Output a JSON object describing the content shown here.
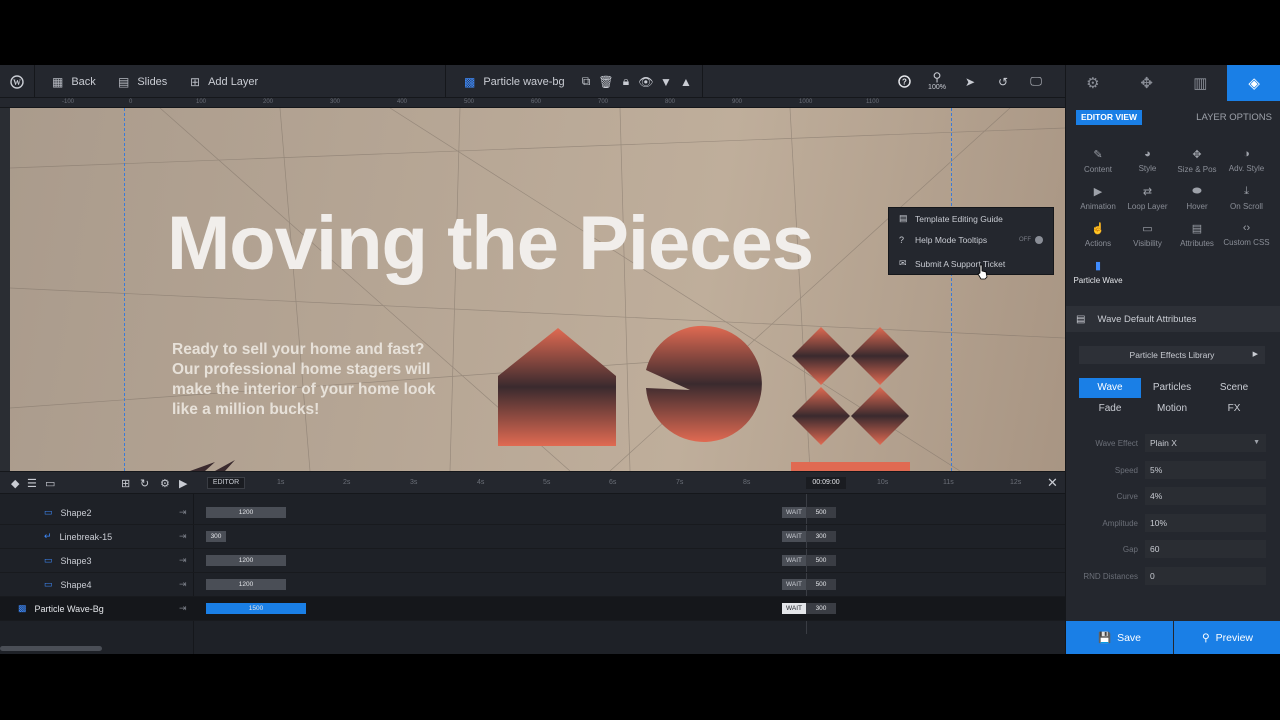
{
  "toolbar": {
    "back_label": "Back",
    "slides_label": "Slides",
    "add_layer_label": "Add Layer",
    "layer_title": "Particle wave-bg",
    "zoom": "100%"
  },
  "ruler": {
    "ticks": [
      "-100",
      "0",
      "100",
      "200",
      "300",
      "400",
      "500",
      "600",
      "700",
      "800",
      "900",
      "1000",
      "1100"
    ]
  },
  "canvas": {
    "headline": "Moving the Pieces",
    "subtext": "Ready to sell your home and fast? Our professional home stagers will make the interior of your home look like a million bucks!"
  },
  "help_menu": {
    "items": [
      {
        "label": "Template Editing Guide",
        "icon": "book-icon"
      },
      {
        "label": "Help Mode Tooltips",
        "icon": "help-icon"
      },
      {
        "label": "Submit A Support Ticket",
        "icon": "ticket-icon"
      }
    ],
    "tooltips_state": "OFF"
  },
  "timeline": {
    "editor_tab": "EDITOR",
    "time_marks": [
      "1s",
      "2s",
      "3s",
      "4s",
      "5s",
      "6s",
      "7s",
      "8s",
      "10s",
      "11s",
      "12s"
    ],
    "current_time": "00:09:00",
    "wait_label": "WAIT",
    "rows": [
      {
        "name": "Shape2",
        "duration": "1200",
        "wait": "500"
      },
      {
        "name": "Linebreak-15",
        "duration": "300",
        "wait": "300"
      },
      {
        "name": "Shape3",
        "duration": "1200",
        "wait": "500"
      },
      {
        "name": "Shape4",
        "duration": "1200",
        "wait": "500"
      },
      {
        "name": "Particle Wave-Bg",
        "duration": "1500",
        "wait": "300"
      }
    ]
  },
  "right_panel": {
    "editor_view": "EDITOR VIEW",
    "layer_options": "LAYER OPTIONS",
    "options": [
      {
        "label": "Content",
        "icon": "pen-icon"
      },
      {
        "label": "Style",
        "icon": "palette-icon"
      },
      {
        "label": "Size & Pos",
        "icon": "move-icon"
      },
      {
        "label": "Adv. Style",
        "icon": "contrast-icon"
      },
      {
        "label": "Animation",
        "icon": "play-icon"
      },
      {
        "label": "Loop Layer",
        "icon": "loop-icon"
      },
      {
        "label": "Hover",
        "icon": "mouse-icon"
      },
      {
        "label": "On Scroll",
        "icon": "scroll-icon"
      },
      {
        "label": "Actions",
        "icon": "hand-icon"
      },
      {
        "label": "Visibility",
        "icon": "monitor-icon"
      },
      {
        "label": "Attributes",
        "icon": "document-icon"
      },
      {
        "label": "Custom CSS",
        "icon": "code-icon"
      },
      {
        "label": "Particle Wave",
        "icon": "wave-bars-icon"
      }
    ],
    "section_title": "Wave Default Attributes",
    "library_label": "Particle Effects Library",
    "segments": [
      "Wave",
      "Particles",
      "Scene",
      "Fade",
      "Motion",
      "FX"
    ],
    "active_segment": "Wave",
    "fields": [
      {
        "label": "Wave Effect",
        "value": "Plain X"
      },
      {
        "label": "Speed",
        "value": "5%"
      },
      {
        "label": "Curve",
        "value": "4%"
      },
      {
        "label": "Amplitude",
        "value": "10%"
      },
      {
        "label": "Gap",
        "value": "60"
      },
      {
        "label": "RND Distances",
        "value": "0"
      }
    ],
    "save_label": "Save",
    "preview_label": "Preview"
  },
  "colors": {
    "accent": "#1a7fe6",
    "shape_top": "#e06a52",
    "shape_bottom": "#3a2a2e"
  }
}
